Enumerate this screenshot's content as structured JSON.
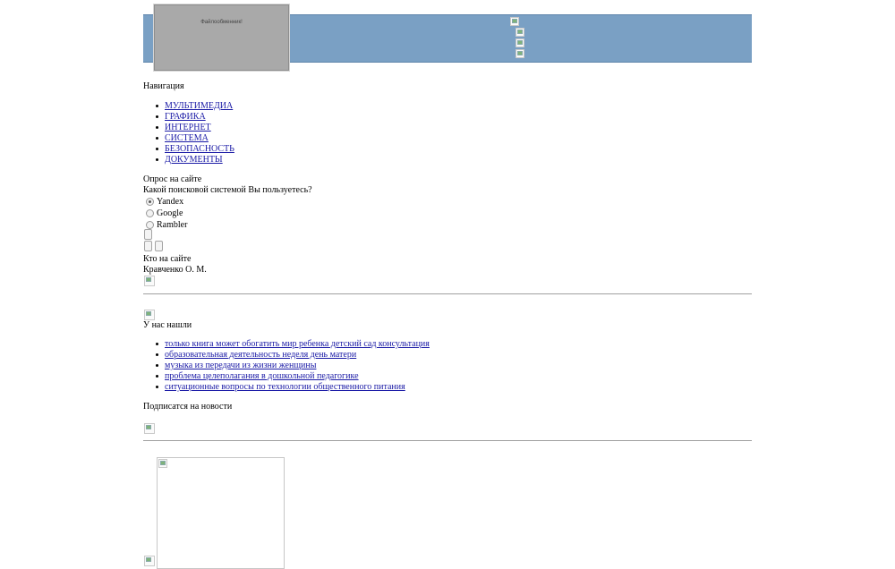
{
  "header": {
    "logo_alt": "Файлообменник!"
  },
  "navigation": {
    "heading": "Навигация",
    "items": [
      {
        "label": "МУЛЬТИМЕДИА"
      },
      {
        "label": "ГРАФИКА"
      },
      {
        "label": "ИНТЕРНЕТ"
      },
      {
        "label": "СИСТЕМА"
      },
      {
        "label": "БЕЗОПАСНОСТЬ"
      },
      {
        "label": "ДОКУМЕНТЫ"
      }
    ]
  },
  "poll": {
    "heading": "Опрос на сайте",
    "question": "Какой поисковой системой Вы пользуетесь?",
    "options": [
      {
        "label": "Yandex",
        "selected": true
      },
      {
        "label": "Google",
        "selected": false
      },
      {
        "label": "Rambler",
        "selected": false
      }
    ]
  },
  "online": {
    "heading": "Кто на сайте",
    "user": "Кравченко О. М."
  },
  "found": {
    "heading": "У нас нашли",
    "items": [
      {
        "label": "только книга может обогатить мир ребенка детский сад консультация"
      },
      {
        "label": "образовательная деятельность неделя день матери"
      },
      {
        "label": "музыка из передачи из жизни женщины"
      },
      {
        "label": "проблема целеполагания в дошкольной педагогике"
      },
      {
        "label": "ситуационные вопросы по технологии общественного питания"
      }
    ]
  },
  "subscribe": {
    "heading": "Подписатся на новости"
  },
  "icons": {
    "broken_image": "broken-image-icon"
  }
}
